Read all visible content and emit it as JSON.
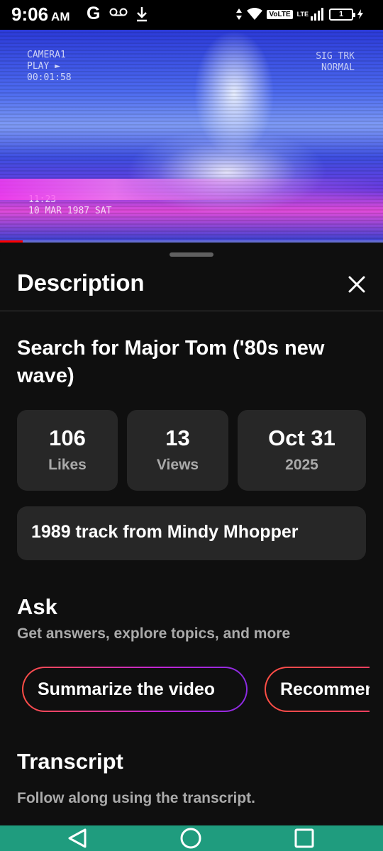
{
  "status_bar": {
    "time": "9:06",
    "ampm": "AM",
    "google": "G",
    "volte": "VoLTE",
    "lte": "LTE",
    "battery": "1"
  },
  "video": {
    "overlay_left": [
      "CAMERA1",
      "PLAY ►",
      "00:01:58"
    ],
    "overlay_right": [
      "SIG TRK",
      "NORMAL"
    ],
    "overlay_bottom": [
      "11:23",
      "10 MAR 1987 SAT"
    ],
    "progress": 0.06
  },
  "sheet": {
    "title": "Description",
    "video_title": "Search for Major Tom ('80s new wave)",
    "stats": {
      "likes_value": "106",
      "likes_label": "Likes",
      "views_value": "13",
      "views_label": "Views",
      "date_value": "Oct 31",
      "date_year": "2025"
    },
    "description": "1989 track from Mindy Mhopper",
    "ask": {
      "title": "Ask",
      "subtitle": "Get answers, explore topics, and more",
      "chips": [
        "Summarize the video",
        "Recommend related content"
      ]
    },
    "transcript": {
      "title": "Transcript",
      "subtitle": "Follow along using the transcript."
    }
  },
  "icons": {
    "close": "close-icon",
    "back": "back-triangle-icon",
    "home": "home-circle-icon",
    "recents": "recents-square-icon"
  },
  "colors": {
    "background": "#0f0f0f",
    "card": "#272727",
    "secondary_text": "#aaaaaa",
    "navbar": "#1f9c7e",
    "chip_gradient_start": "#ff4e45",
    "chip_gradient_end": "#8a2be2"
  }
}
